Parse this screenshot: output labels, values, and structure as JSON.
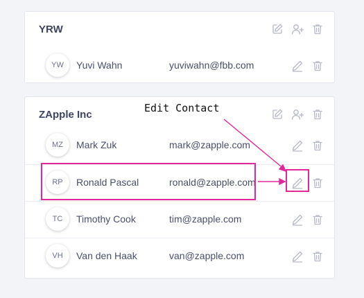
{
  "groups": [
    {
      "name": "YRW",
      "contacts": [
        {
          "initials": "YW",
          "name": "Yuvi Wahn",
          "email": "yuviwahn@fbb.com"
        }
      ]
    },
    {
      "name": "ZApple Inc",
      "contacts": [
        {
          "initials": "MZ",
          "name": "Mark Zuk",
          "email": "mark@zapple.com"
        },
        {
          "initials": "RP",
          "name": "Ronald Pascal",
          "email": "ronald@zapple.com"
        },
        {
          "initials": "TC",
          "name": "Timothy Cook",
          "email": "tim@zapple.com"
        },
        {
          "initials": "VH",
          "name": "Van den Haak",
          "email": "van@zapple.com"
        }
      ]
    }
  ],
  "annotation": {
    "label": "Edit Contact",
    "color": "#e0289a"
  },
  "colors": {
    "icon": "#b5b8c6",
    "background": "#f3f4f8"
  },
  "icons": {
    "group_edit": "edit-square-icon",
    "add_user": "add-user-icon",
    "delete": "trash-icon",
    "contact_edit": "pencil-icon"
  }
}
